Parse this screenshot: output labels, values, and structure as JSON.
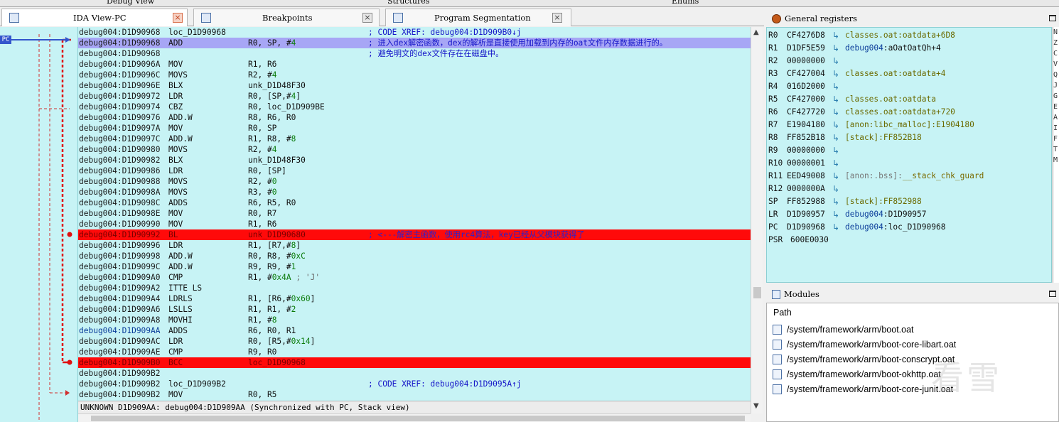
{
  "top_tabs": [
    "Debug View",
    "Structures",
    "Enums"
  ],
  "tabs": [
    {
      "label": "IDA View-PC",
      "active": true
    },
    {
      "label": "Breakpoints",
      "active": false
    },
    {
      "label": "Program Segmentation",
      "active": false
    }
  ],
  "close_glyph": "×",
  "pc_marker": "PC",
  "listing": [
    {
      "addr": "debug004:D1D90968",
      "label": "loc_D1D90968",
      "comment": "; CODE XREF: debug004:D1D909B0↓j"
    },
    {
      "addr": "debug004:D1D90968",
      "mnem": "ADD",
      "ops": "R0, SP, #4",
      "comment": "; 进入dex解密函数，dex的解析是直接使用加载到内存的oat文件内存数据进行的。",
      "state": "sel"
    },
    {
      "addr": "debug004:D1D90968",
      "comment": "; 避免明文的dex文件存在在磁盘中。"
    },
    {
      "addr": "debug004:D1D9096A",
      "mnem": "MOV",
      "ops": "R1, R6"
    },
    {
      "addr": "debug004:D1D9096C",
      "mnem": "MOVS",
      "ops": "R2, #4"
    },
    {
      "addr": "debug004:D1D9096E",
      "mnem": "BLX",
      "ops": "unk_D1D48F30"
    },
    {
      "addr": "debug004:D1D90972",
      "mnem": "LDR",
      "ops": "R0, [SP,#4]"
    },
    {
      "addr": "debug004:D1D90974",
      "mnem": "CBZ",
      "ops": "R0, loc_D1D909BE"
    },
    {
      "addr": "debug004:D1D90976",
      "mnem": "ADD.W",
      "ops": "R8, R6, R0"
    },
    {
      "addr": "debug004:D1D9097A",
      "mnem": "MOV",
      "ops": "R0, SP"
    },
    {
      "addr": "debug004:D1D9097C",
      "mnem": "ADD.W",
      "ops": "R1, R8, #8"
    },
    {
      "addr": "debug004:D1D90980",
      "mnem": "MOVS",
      "ops": "R2, #4"
    },
    {
      "addr": "debug004:D1D90982",
      "mnem": "BLX",
      "ops": "unk_D1D48F30"
    },
    {
      "addr": "debug004:D1D90986",
      "mnem": "LDR",
      "ops": "R0, [SP]"
    },
    {
      "addr": "debug004:D1D90988",
      "mnem": "MOVS",
      "ops": "R2, #0"
    },
    {
      "addr": "debug004:D1D9098A",
      "mnem": "MOVS",
      "ops": "R3, #0"
    },
    {
      "addr": "debug004:D1D9098C",
      "mnem": "ADDS",
      "ops": "R6, R5, R0"
    },
    {
      "addr": "debug004:D1D9098E",
      "mnem": "MOV",
      "ops": "R0, R7"
    },
    {
      "addr": "debug004:D1D90990",
      "mnem": "MOV",
      "ops": "R1, R6"
    },
    {
      "addr": "debug004:D1D90992",
      "mnem": "BL",
      "ops": "unk_D1D90680",
      "comment": "; <---解密主函数，使用rc4算法，key已经从父模块获得了",
      "state": "bp"
    },
    {
      "addr": "debug004:D1D90996",
      "mnem": "LDR",
      "ops": "R1, [R7,#8]"
    },
    {
      "addr": "debug004:D1D90998",
      "mnem": "ADD.W",
      "ops": "R0, R8, #0xC"
    },
    {
      "addr": "debug004:D1D9099C",
      "mnem": "ADD.W",
      "ops": "R9, R9, #1"
    },
    {
      "addr": "debug004:D1D909A0",
      "mnem": "CMP",
      "ops": "R1, #0x4A ; 'J'"
    },
    {
      "addr": "debug004:D1D909A2",
      "mnem": "ITTE LS",
      "ops": ""
    },
    {
      "addr": "debug004:D1D909A4",
      "mnem": "LDRLS",
      "ops": "R1, [R6,#0x60]"
    },
    {
      "addr": "debug004:D1D909A6",
      "mnem": "LSLLS",
      "ops": "R1, R1, #2"
    },
    {
      "addr": "debug004:D1D909A8",
      "mnem": "MOVHI",
      "ops": "R1, #8"
    },
    {
      "addr": "debug004:D1D909AA",
      "mnem": "ADDS",
      "ops": "R6, R0, R1",
      "blue": true
    },
    {
      "addr": "debug004:D1D909AC",
      "mnem": "LDR",
      "ops": "R0, [R5,#0x14]"
    },
    {
      "addr": "debug004:D1D909AE",
      "mnem": "CMP",
      "ops": "R9, R0"
    },
    {
      "addr": "debug004:D1D909B0",
      "mnem": "BCC",
      "ops": "loc_D1D90968",
      "state": "bp"
    },
    {
      "addr": "debug004:D1D909B2",
      "mnem": "",
      "ops": ""
    },
    {
      "addr": "debug004:D1D909B2",
      "label": "loc_D1D909B2",
      "comment": "; CODE XREF: debug004:D1D9095A↑j"
    },
    {
      "addr": "debug004:D1D909B2",
      "mnem": "MOV",
      "ops": "R0, R5"
    }
  ],
  "status": "UNKNOWN D1D909AA: debug004:D1D909AA (Synchronized with PC, Stack view)",
  "registers": {
    "title": "General registers",
    "rows": [
      {
        "name": "R0",
        "value": "CF4276D8",
        "target": "classes.oat:oatdata+6D8",
        "kind": "oat"
      },
      {
        "name": "R1",
        "value": "D1DF5E59",
        "target": "debug004:aOatOatQh+4",
        "kind": "dbg"
      },
      {
        "name": "R2",
        "value": "00000000",
        "target": "",
        "kind": ""
      },
      {
        "name": "R3",
        "value": "CF427004",
        "target": "classes.oat:oatdata+4",
        "kind": "oat"
      },
      {
        "name": "R4",
        "value": "016D2000",
        "target": "",
        "kind": ""
      },
      {
        "name": "R5",
        "value": "CF427000",
        "target": "classes.oat:oatdata",
        "kind": "oat"
      },
      {
        "name": "R6",
        "value": "CF427720",
        "target": "classes.oat:oatdata+720",
        "kind": "oat"
      },
      {
        "name": "R7",
        "value": "E1904180",
        "target": "[anon:libc_malloc]:E1904180",
        "kind": "oat"
      },
      {
        "name": "R8",
        "value": "FF852B18",
        "target": "[stack]:FF852B18",
        "kind": "oat"
      },
      {
        "name": "R9",
        "value": "00000000",
        "target": "",
        "kind": ""
      },
      {
        "name": "R10",
        "value": "00000001",
        "target": "",
        "kind": ""
      },
      {
        "name": "R11",
        "value": "EED49008",
        "target": "[anon:.bss]:__stack_chk_guard",
        "kind": "anon"
      },
      {
        "name": "R12",
        "value": "0000000A",
        "target": "",
        "kind": ""
      },
      {
        "name": "SP",
        "value": "FF852988",
        "target": "[stack]:FF852988",
        "kind": "oat"
      },
      {
        "name": "LR",
        "value": "D1D90957",
        "target": "debug004:D1D90957",
        "kind": "dbg"
      },
      {
        "name": "PC",
        "value": "D1D90968",
        "target": "debug004:loc_D1D90968",
        "kind": "dbg"
      },
      {
        "name": "PSR",
        "value": "600E0030",
        "target": null,
        "kind": ""
      }
    ],
    "arrow_glyph": "↳"
  },
  "right_strip_chars": [
    "N",
    "Z",
    "C",
    "V",
    "Q",
    "J",
    "G",
    "E",
    "A",
    "I",
    "F",
    "T",
    "M"
  ],
  "modules": {
    "title": "Modules",
    "header": "Path",
    "paths": [
      "/system/framework/arm/boot.oat",
      "/system/framework/arm/boot-core-libart.oat",
      "/system/framework/arm/boot-conscrypt.oat",
      "/system/framework/arm/boot-okhttp.oat",
      "/system/framework/arm/boot-core-junit.oat"
    ]
  },
  "watermark": "看雪",
  "colors": {
    "listing_bg": "#c7f3f5",
    "selection": "#a7a6f5",
    "breakpoint": "#ff0a0a",
    "comment": "#1414c8",
    "numeric": "#0a7a0a"
  }
}
